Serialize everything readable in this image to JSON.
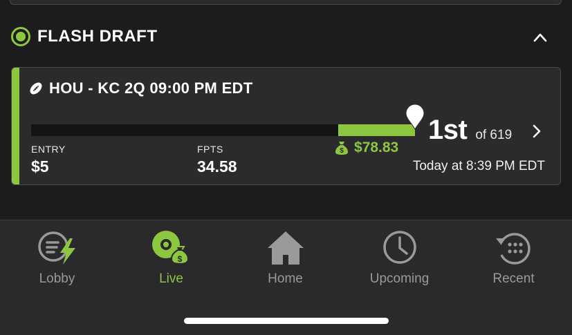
{
  "section": {
    "title": "FLASH DRAFT"
  },
  "contest": {
    "game": "HOU - KC 2Q 09:00 PM EDT",
    "entry_label": "ENTRY",
    "entry_value": "$5",
    "fpts_label": "FPTS",
    "fpts_value": "34.58",
    "winnings": "$78.83",
    "rank": "1st",
    "rank_of": "of 619",
    "timestamp": "Today at 8:39 PM EDT",
    "progress_fraction": 0.2
  },
  "tabs": [
    {
      "label": "Lobby",
      "icon": "lobby-lightning-icon",
      "active": false
    },
    {
      "label": "Live",
      "icon": "live-money-icon",
      "active": true
    },
    {
      "label": "Home",
      "icon": "home-icon",
      "active": false
    },
    {
      "label": "Upcoming",
      "icon": "clock-icon",
      "active": false
    },
    {
      "label": "Recent",
      "icon": "recent-history-icon",
      "active": false
    }
  ],
  "colors": {
    "accent": "#8dc63f",
    "background": "#1c1c1d",
    "card": "#2b2b2d",
    "tab_inactive": "#9a9a9a"
  }
}
